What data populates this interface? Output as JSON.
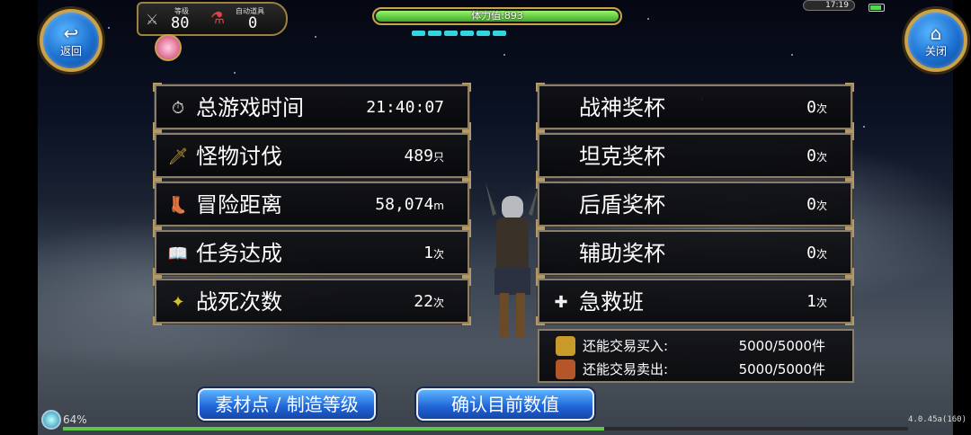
{
  "header": {
    "back_label": "返回",
    "close_label": "关闭",
    "level_caption": "等级",
    "level_value": "80",
    "auto_item_caption": "自动道具",
    "auto_item_value": "0",
    "stamina_label": "体力值:893",
    "stamina_fraction": 0.98,
    "clock": "17:19"
  },
  "stats_left": [
    {
      "icon": "stopwatch-icon",
      "label": "总游戏时间",
      "value": "21:40:07",
      "unit": ""
    },
    {
      "icon": "sword-icon",
      "label": "怪物讨伐",
      "value": "489",
      "unit": "只"
    },
    {
      "icon": "boot-icon",
      "label": "冒险距离",
      "value": "58,074",
      "unit": "m"
    },
    {
      "icon": "book-icon",
      "label": "任务达成",
      "value": "1",
      "unit": "次"
    },
    {
      "icon": "spiral-star-icon",
      "label": "战死次数",
      "value": "22",
      "unit": "次"
    }
  ],
  "stats_right": [
    {
      "icon": "",
      "label": "战神奖杯",
      "value": "0",
      "unit": "次"
    },
    {
      "icon": "",
      "label": "坦克奖杯",
      "value": "0",
      "unit": "次"
    },
    {
      "icon": "",
      "label": "后盾奖杯",
      "value": "0",
      "unit": "次"
    },
    {
      "icon": "",
      "label": "辅助奖杯",
      "value": "0",
      "unit": "次"
    },
    {
      "icon": "medic-icon",
      "label": "急救班",
      "value": "1",
      "unit": "次"
    }
  ],
  "trade": [
    {
      "icon": "treasure-buy-icon",
      "label": "还能交易买入:",
      "value": "5000/5000件"
    },
    {
      "icon": "treasure-sell-icon",
      "label": "还能交易卖出:",
      "value": "5000/5000件"
    }
  ],
  "buttons": {
    "materials_label": "素材点 / 制造等级",
    "confirm_label": "确认目前数值"
  },
  "footer": {
    "progress_percent": "64%",
    "progress_fraction": 0.64,
    "version": "4.0.45a(160)"
  },
  "colors": {
    "panel_border": "#8a7e68",
    "accent_gold": "#c9a24a",
    "button_blue": "#1e63d6",
    "stamina_green": "#3caa28"
  }
}
